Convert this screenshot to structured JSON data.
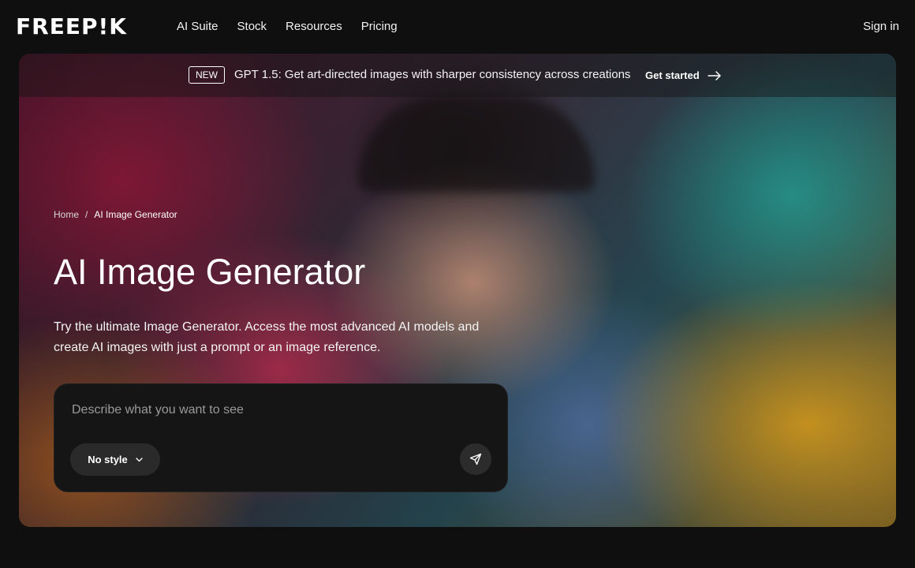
{
  "header": {
    "logo": "FREEP!K",
    "nav": [
      "AI Suite",
      "Stock",
      "Resources",
      "Pricing"
    ],
    "sign_in": "Sign in"
  },
  "announcement": {
    "badge": "NEW",
    "text": "GPT 1.5: Get art-directed images with sharper consistency across creations",
    "cta": "Get started"
  },
  "breadcrumb": {
    "home": "Home",
    "separator": "/",
    "current": "AI Image Generator"
  },
  "hero": {
    "title": "AI Image Generator",
    "description": "Try the ultimate Image Generator. Access the most advanced AI models and create AI images with just a prompt or an image reference."
  },
  "prompt": {
    "placeholder": "Describe what you want to see",
    "value": "",
    "style_label": "No style"
  },
  "icons": {
    "arrow": "arrow-right-icon",
    "chevron": "chevron-down-icon",
    "send": "send-icon"
  }
}
